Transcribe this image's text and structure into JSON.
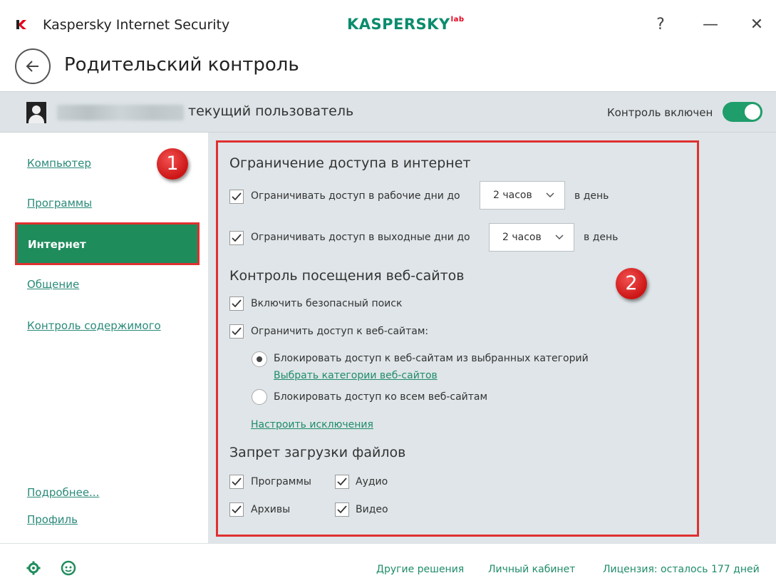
{
  "window": {
    "app_title": "Kaspersky Internet Security",
    "brand": "KASPERSKY",
    "brand_sup": "lab",
    "help_label": "?",
    "minimize_label": "—",
    "close_label": "✕"
  },
  "header": {
    "page_title": "Родительский контроль"
  },
  "userbar": {
    "current_user_label": "текущий пользователь",
    "control_label": "Контроль включен",
    "control_enabled": true
  },
  "sidebar": {
    "items": [
      {
        "label": "Компьютер"
      },
      {
        "label": "Программы"
      },
      {
        "label": "Интернет"
      },
      {
        "label": "Общение"
      },
      {
        "label": "Контроль содержимого"
      }
    ],
    "more_label": "Подробнее...",
    "profile_label": "Профиль"
  },
  "badges": {
    "one": "1",
    "two": "2"
  },
  "internet_access": {
    "title": "Ограничение доступа в интернет",
    "workdays_label": "Ограничивать доступ в рабочие дни до",
    "workdays_checked": true,
    "workdays_value": "2 часов",
    "weekends_label": "Ограничивать доступ в выходные дни до",
    "weekends_checked": true,
    "weekends_value": "2 часов",
    "per_day": "в день"
  },
  "web_control": {
    "title": "Контроль посещения веб-сайтов",
    "safe_search_label": "Включить безопасный поиск",
    "safe_search_checked": true,
    "restrict_label": "Ограничить доступ к веб-сайтам:",
    "restrict_checked": true,
    "block_categories_label": "Блокировать доступ к веб-сайтам из выбранных категорий",
    "block_categories_selected": true,
    "choose_categories_link": "Выбрать категории веб-сайтов",
    "block_all_label": "Блокировать доступ ко всем веб-сайтам",
    "block_all_selected": false,
    "exceptions_link": "Настроить исключения"
  },
  "downloads": {
    "title": "Запрет загрузки файлов",
    "programs_label": "Программы",
    "audio_label": "Аудио",
    "archives_label": "Архивы",
    "video_label": "Видео"
  },
  "footer": {
    "other_solutions": "Другие решения",
    "my_account": "Личный кабинет",
    "license": "Лицензия: осталось 177 дней"
  },
  "colors": {
    "accent": "#1f8c5c",
    "link": "#1f8c6a",
    "annotation_red": "#e03030"
  }
}
